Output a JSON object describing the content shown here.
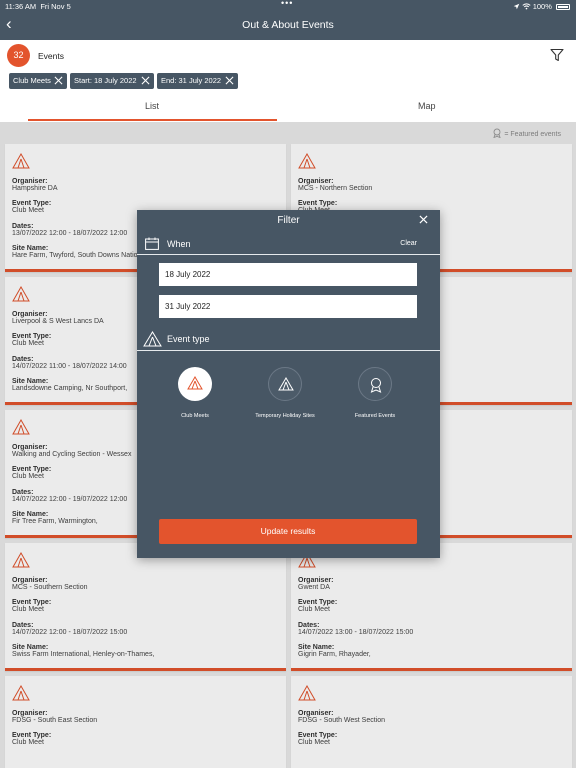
{
  "status_bar": {
    "time": "11:36 AM",
    "date": "Fri Nov 5",
    "battery": "100%"
  },
  "nav": {
    "title": "Out & About Events"
  },
  "header": {
    "count": "32",
    "title": "Events",
    "chips": [
      "Club Meets",
      "Start: 18 July 2022",
      "End: 31 July 2022"
    ],
    "tabs": [
      "List",
      "Map"
    ],
    "legend": "= Featured events"
  },
  "labels": {
    "organiser": "Organiser:",
    "event_type": "Event Type:",
    "dates": "Dates:",
    "site_name": "Site Name:"
  },
  "cards": [
    {
      "organiser": "Hampshire DA",
      "event_type": "Club Meet",
      "dates": "13/07/2022 12:00 - 18/07/2022 12:00",
      "site_name": "Hare Farm, Twyford, South Downs National Park,"
    },
    {
      "organiser": "MCS - Northern Section",
      "event_type": "Club Meet",
      "dates": "",
      "site_name": ""
    },
    {
      "organiser": "Liverpool & S West Lancs DA",
      "event_type": "Club Meet",
      "dates": "14/07/2022 11:00 - 18/07/2022 14:00",
      "site_name": "Landsdowne Camping, Nr Southport,"
    },
    {
      "organiser": "",
      "event_type": "",
      "dates": "",
      "site_name": ""
    },
    {
      "organiser": "Walking and Cycling Section - Wessex",
      "event_type": "Club Meet",
      "dates": "14/07/2022 12:00 - 19/07/2022 12:00",
      "site_name": "Fir Tree Farm, Warmington,"
    },
    {
      "organiser": "",
      "event_type": "",
      "dates": "",
      "site_name": ""
    },
    {
      "organiser": "MCS - Southern Section",
      "event_type": "Club Meet",
      "dates": "14/07/2022 12:00 - 18/07/2022 15:00",
      "site_name": "Swiss Farm International, Henley-on-Thames,"
    },
    {
      "organiser": "Gwent DA",
      "event_type": "Club Meet",
      "dates": "14/07/2022 13:00 - 18/07/2022 15:00",
      "site_name": "Gigrin Farm, Rhayader,"
    },
    {
      "organiser": "FDSG - South East Section",
      "event_type": "Club Meet",
      "dates": "",
      "site_name": ""
    },
    {
      "organiser": "FDSG - South West Section",
      "event_type": "Club Meet",
      "dates": "",
      "site_name": ""
    }
  ],
  "filter": {
    "title": "Filter",
    "when_title": "When",
    "clear_label": "Clear",
    "start_date": "18 July 2022",
    "end_date": "31 July 2022",
    "event_type_title": "Event type",
    "types": [
      "Club Meets",
      "Temporary Holiday Sites",
      "Featured Events"
    ],
    "update_label": "Update results"
  },
  "colors": {
    "accent": "#e3542d",
    "slate": "#475664",
    "background": "#ececec"
  }
}
